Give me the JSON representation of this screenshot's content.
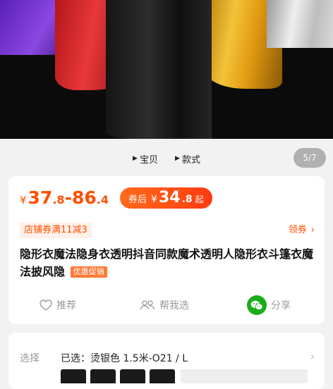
{
  "gallery": {
    "tabs": [
      {
        "label": "宝贝"
      },
      {
        "label": "款式"
      }
    ],
    "page_counter": "5/7"
  },
  "price": {
    "currency": "¥",
    "low_int": "37",
    "low_dec": ".8",
    "sep": "-",
    "high_int": "86",
    "high_dec": ".4"
  },
  "coupon_price": {
    "tag": "券后",
    "currency": "¥",
    "int": "34",
    "dec": ".8",
    "suffix": "起"
  },
  "shop_coupon": "店铺券满11减3",
  "claim_coupon": {
    "label": "领券",
    "chevron": "›"
  },
  "product": {
    "title": "隐形衣魔法隐身衣透明抖音同款魔术透明人隐形衣斗篷衣魔法披风隐",
    "badge": "优惠促销"
  },
  "actions": {
    "recommend": "推荐",
    "help_choose": "帮我选",
    "share": "分享"
  },
  "spec": {
    "label": "选择",
    "selected": "已选：烫银色 1.5米-O21 / L",
    "chevron": "›"
  },
  "colors": {
    "accent": "#ff5000",
    "wechat_green": "#1aad19"
  }
}
